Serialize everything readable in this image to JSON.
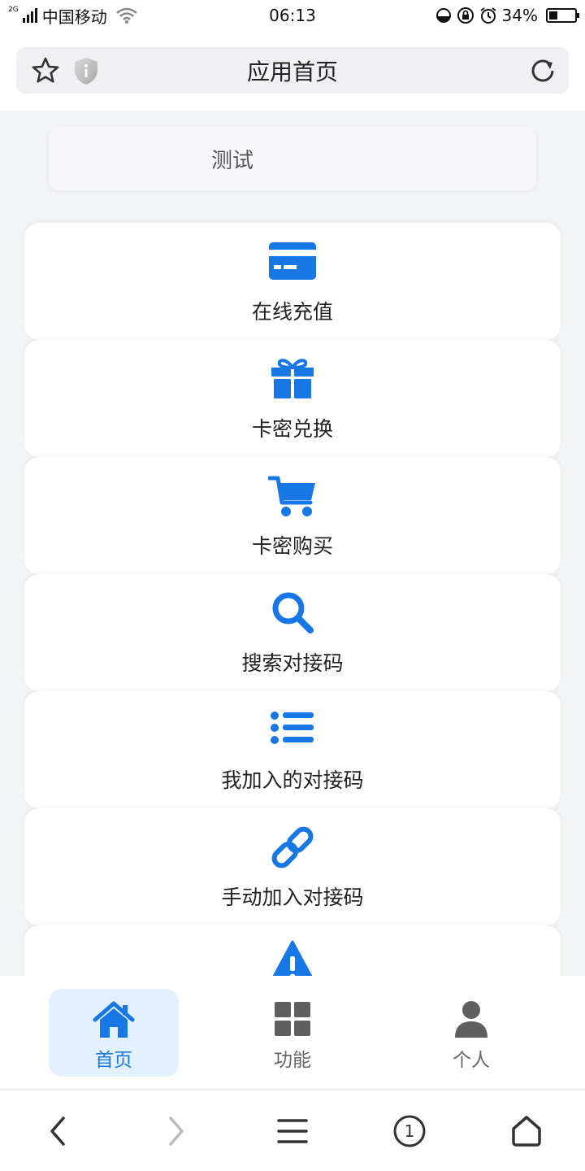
{
  "status_bar": {
    "network": "2G",
    "carrier": "中国移动",
    "time": "06:13",
    "battery": "34%",
    "battery_level": 0.34
  },
  "browser": {
    "page_title": "应用首页"
  },
  "notice": {
    "text": "测试"
  },
  "menu": {
    "items": [
      {
        "label": "在线充值",
        "icon": "credit-card-icon"
      },
      {
        "label": "卡密兑换",
        "icon": "gift-icon"
      },
      {
        "label": "卡密购买",
        "icon": "shopping-cart-icon"
      },
      {
        "label": "搜索对接码",
        "icon": "search-icon"
      },
      {
        "label": "我加入的对接码",
        "icon": "list-icon"
      },
      {
        "label": "手动加入对接码",
        "icon": "link-icon"
      },
      {
        "label": "",
        "icon": "warning-icon"
      }
    ]
  },
  "tabbar": {
    "tabs": [
      {
        "label": "首页",
        "icon": "home-icon",
        "active": true
      },
      {
        "label": "功能",
        "icon": "grid-icon",
        "active": false
      },
      {
        "label": "个人",
        "icon": "user-icon",
        "active": false
      }
    ]
  },
  "browser_nav": {
    "tab_count": "1"
  },
  "colors": {
    "accent": "#1677e5",
    "icon_gray": "#5f5f5f",
    "page_bg": "#f3f4f6"
  }
}
